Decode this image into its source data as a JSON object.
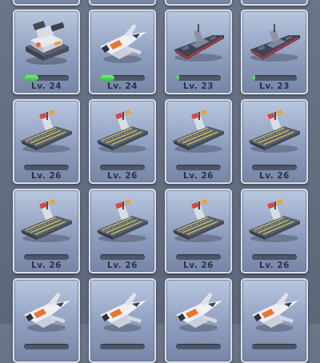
{
  "colors": {
    "background": "#646c80",
    "card_top": "#b9c7df",
    "card_bottom": "#7786a6",
    "bar_track": "#4e566a",
    "bar_fill": "#2bc43a",
    "level_text": "#2b3246"
  },
  "cards": [
    {
      "unit": "tank-icon",
      "level": "",
      "progress": 0
    },
    {
      "unit": "fighter-jet-icon",
      "level": "",
      "progress": 0
    },
    {
      "unit": "warship-icon",
      "level": "",
      "progress": 0
    },
    {
      "unit": "warship-icon",
      "level": "",
      "progress": 0
    },
    {
      "unit": "tank-icon",
      "level": "Lv. 24",
      "progress": 0.33
    },
    {
      "unit": "fighter-jet-icon",
      "level": "Lv. 24",
      "progress": 0.33
    },
    {
      "unit": "warship-icon",
      "level": "Lv. 23",
      "progress": 0.08
    },
    {
      "unit": "warship-icon",
      "level": "Lv. 23",
      "progress": 0.08
    },
    {
      "unit": "aircraft-carrier-icon",
      "level": "Lv. 26",
      "progress": 0
    },
    {
      "unit": "aircraft-carrier-icon",
      "level": "Lv. 26",
      "progress": 0
    },
    {
      "unit": "aircraft-carrier-icon",
      "level": "Lv. 26",
      "progress": 0
    },
    {
      "unit": "aircraft-carrier-icon",
      "level": "Lv. 26",
      "progress": 0
    },
    {
      "unit": "aircraft-carrier-icon",
      "level": "Lv. 26",
      "progress": 0
    },
    {
      "unit": "aircraft-carrier-icon",
      "level": "Lv. 26",
      "progress": 0
    },
    {
      "unit": "aircraft-carrier-icon",
      "level": "Lv. 26",
      "progress": 0
    },
    {
      "unit": "aircraft-carrier-icon",
      "level": "Lv. 26",
      "progress": 0
    },
    {
      "unit": "fighter-jet-icon",
      "level": "",
      "progress": 0
    },
    {
      "unit": "fighter-jet-icon",
      "level": "",
      "progress": 0
    },
    {
      "unit": "fighter-jet-icon",
      "level": "",
      "progress": 0
    },
    {
      "unit": "fighter-jet-icon",
      "level": "",
      "progress": 0
    }
  ]
}
